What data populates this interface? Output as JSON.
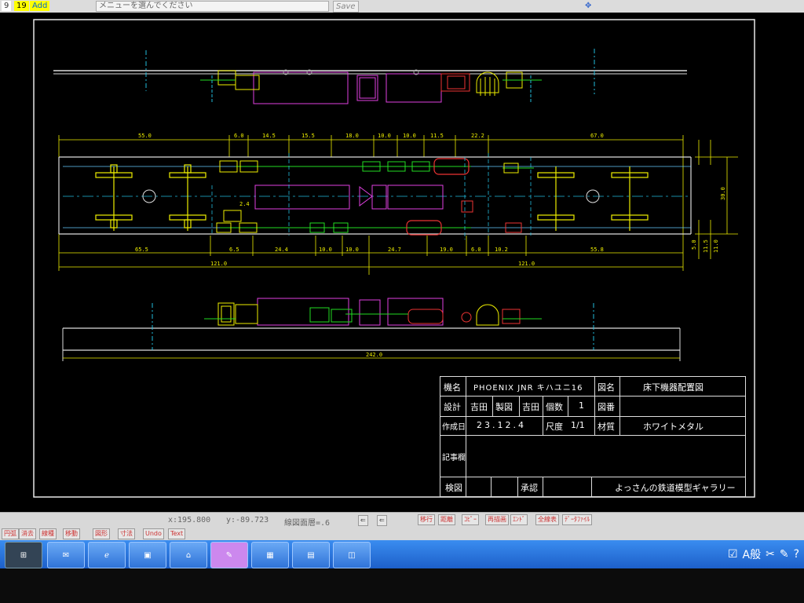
{
  "toolbar": {
    "page_num": "9",
    "add_label": "Add",
    "menu_placeholder": "メニューを選んでください",
    "save_label": "Save",
    "move_icon": "move-cross-icon"
  },
  "drawing": {
    "dimensions": {
      "top_55": "55.0",
      "top_6a": "6.0",
      "top_14": "14.5",
      "top_15": "15.5",
      "top_18": "18.0",
      "top_10a": "10.0",
      "top_10b": "10.0",
      "top_11": "11.5",
      "top_22": "22.2",
      "top_67": "67.0",
      "mid_2": "2.4",
      "bot_65": "65.5",
      "bot_6": "6.5",
      "bot_24": "24.4",
      "bot_10a": "10.0",
      "bot_10b": "10.0",
      "bot_24b": "24.7",
      "bot_19": "19.0",
      "bot_6b": "6.0",
      "bot_10c": "10.2",
      "bot_55": "55.8",
      "half_left": "121.0",
      "half_right": "121.0",
      "overall": "242.0",
      "right_v1": "30.0",
      "right_v2": "5.0",
      "right_v3": "11.5",
      "right_v4": "11.0"
    }
  },
  "title_block": {
    "kimei_label": "機名",
    "kimei_value": "PHOENIX JNR キハユニ16",
    "zumei_label": "図名",
    "zumei_value": "床下機器配置図",
    "sekkei_label": "設計",
    "sekkei_value": "吉田",
    "seizu_label": "製図",
    "seizu_value": "吉田",
    "kosu_label": "個数",
    "kosu_value": "1",
    "zuban_label": "図番",
    "zuban_value": "",
    "sakusei_label": "作成日",
    "sakusei_value": "23.12.4",
    "shakudo_label": "尺度",
    "shakudo_value": "1/1",
    "zaishitsu_label": "材質",
    "zaishitsu_value": "ホワイトメタル",
    "kiji_label": "記事欄",
    "kenzu_label": "検図",
    "shonin_label": "承認",
    "gallery": "よっさんの鉄道模型ギャラリー"
  },
  "status": {
    "x_coord": "x:195.800",
    "y_coord": "y:-89.723",
    "mode_text": "線図面層=.6",
    "buttons": [
      "移行",
      "距離",
      "ｺﾋﾟｰ",
      "再描画",
      "ｴﾝﾄﾞ",
      "全線表",
      "ﾃﾞｰﾀﾌｧｲﾙ"
    ],
    "left_buttons": [
      "円弧",
      "消去",
      "線種",
      "移動",
      "図形",
      "寸法",
      "Undo",
      "Text"
    ]
  },
  "taskbar": {
    "apps": [
      "start-icon",
      "mail-icon",
      "ie-icon",
      "explorer-icon",
      "network-icon",
      "paint-icon",
      "excel-icon",
      "folder-icon",
      "disk-icon"
    ],
    "ime_text": "A般"
  }
}
